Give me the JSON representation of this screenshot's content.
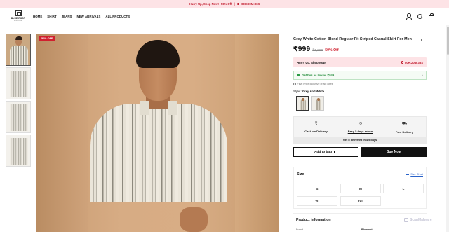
{
  "announcement": {
    "text": "Hurry Up, Shop Now!",
    "discount": "50% Off",
    "timer": "00H:20M:36S"
  },
  "header": {
    "logo_text": "BLUE ROOT",
    "logo_sub": "CLOTHING",
    "nav": [
      "HOME",
      "SHIRT",
      "JEANS",
      "NEW ARRIVALS",
      "ALL PRODUCTS"
    ],
    "icons": [
      "user-icon",
      "search-icon",
      "bag-icon"
    ]
  },
  "gallery": {
    "discount_tag": "50% OFF",
    "thumbnail_count": 4
  },
  "product": {
    "title": "Grey White Cotton Blend Regular Fit Striped Casual Shirt For Men",
    "price": "₹999",
    "mrp": "₹1,999",
    "off": "50% Off",
    "hurry_text": "Hurry Up, Shop Now!",
    "hurry_timer": "00H:20M:36S",
    "coupon_text": "Get this as low as ₹849",
    "tax_note": "Final Price Inclusive of all Taxes",
    "style_label": "Style :",
    "style_value": "Grey And White",
    "services": [
      {
        "icon": "rupee-icon",
        "label": "Cash on Delivery"
      },
      {
        "icon": "exchange-icon",
        "label": "Easy 5 days return"
      },
      {
        "icon": "truck-icon",
        "label": "Free Delivery"
      }
    ],
    "delivery_note": "Get it delivered in 4-9 days",
    "add_to_bag": "Add to bag",
    "buy_now": "Buy Now"
  },
  "size": {
    "label": "Size",
    "chart_link": "Size Chart",
    "options": [
      "S",
      "M",
      "L",
      "XL",
      "2XL"
    ],
    "selected": "S"
  },
  "product_info": {
    "title": "Product Information",
    "brand_label": "Brand",
    "brand_value": "Blueroot"
  },
  "watermark": "ScanMalware",
  "colors": {
    "accent_red": "#d0202e",
    "banner_bg": "#fde3e6",
    "coupon_green": "#1f8a37",
    "link_blue": "#2a63c9"
  }
}
